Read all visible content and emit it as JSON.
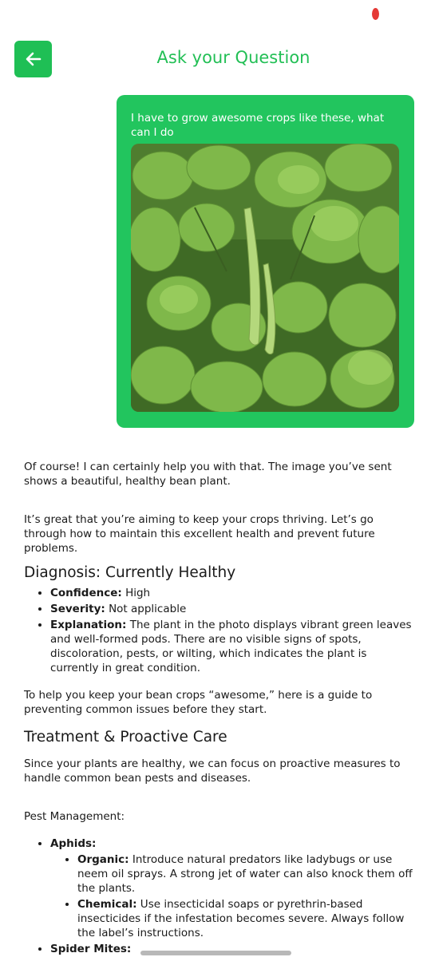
{
  "header": {
    "title": "Ask your Question"
  },
  "user_message": {
    "text": "I have to grow awesome crops like these, what can I do"
  },
  "answer": {
    "intro": "Of course! I can certainly help you with that. The image you’ve sent shows a beautiful, healthy bean plant.",
    "intro2": "It’s great that you’re aiming to keep your crops thriving. Let’s go through how to maintain this excellent health and prevent future problems.",
    "diagnosis_heading": "Diagnosis: Currently Healthy",
    "diagnosis_items": [
      {
        "label": "Confidence:",
        "text": " High"
      },
      {
        "label": "Severity:",
        "text": " Not applicable"
      },
      {
        "label": "Explanation:",
        "text": " The plant in the photo displays vibrant green leaves and well-formed pods. There are no visible signs of spots, discoloration, pests, or wilting, which indicates the plant is currently in great condition."
      }
    ],
    "guide_text": "To help you keep your bean crops “awesome,” here is a guide to preventing common issues before they start.",
    "treatment_heading": "Treatment & Proactive Care",
    "treatment_text": "Since your plants are healthy, we can focus on proactive measures to handle common bean pests and diseases.",
    "pest_heading": "Pest Management:",
    "pests": [
      {
        "name": "Aphids:",
        "items": [
          {
            "label": "Organic:",
            "text": " Introduce natural predators like ladybugs or use neem oil sprays. A strong jet of water can also knock them off the plants."
          },
          {
            "label": "Chemical:",
            "text": " Use insecticidal soaps or pyrethrin-based insecticides if the infestation becomes severe. Always follow the label’s instructions."
          }
        ]
      },
      {
        "name": "Spider Mites:"
      }
    ]
  },
  "colors": {
    "accent": "#22c55e",
    "title": "#22bf55"
  },
  "icons": {
    "back": "arrow-left-icon"
  }
}
